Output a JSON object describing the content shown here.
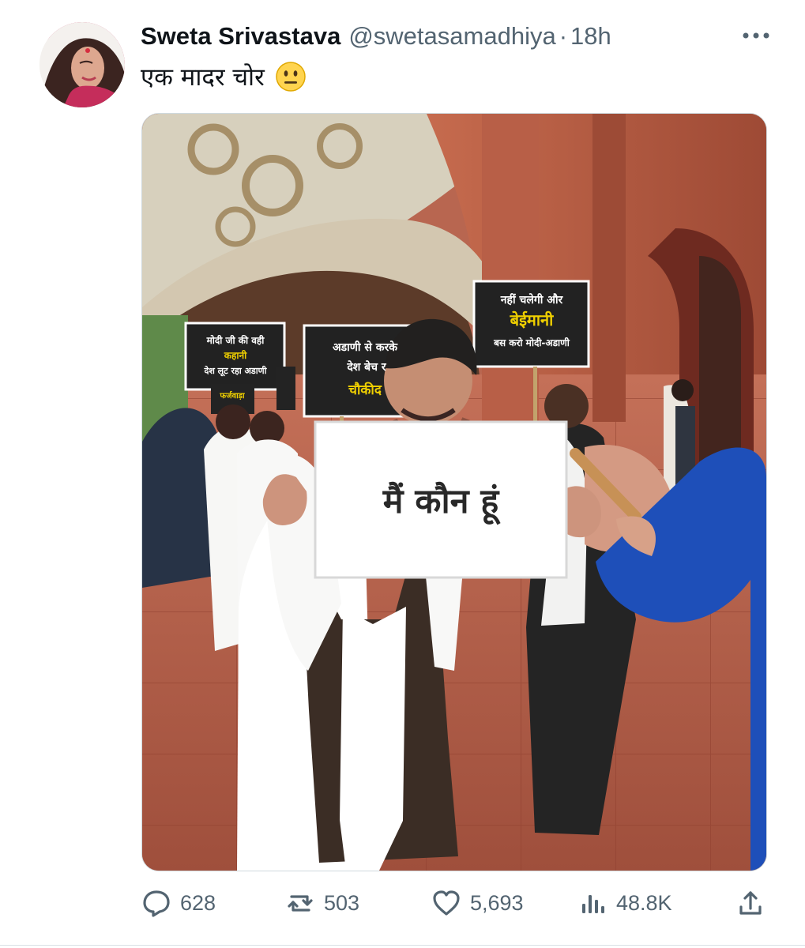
{
  "tweet": {
    "author_name": "Sweta Srivastava",
    "handle": "@swetasamadhiya",
    "separator": "·",
    "time": "18h",
    "text": "एक मादर चोर",
    "emoji": "neutral-face-emoji"
  },
  "media": {
    "main_sign": "मैं कौन हूं",
    "left_sign": [
      "मोदी जी की वही",
      "कहानी",
      "देश लूट रहा अडाणी"
    ],
    "middle_sign": [
      "अडाणी से करके",
      "देश बेच र",
      "चौकीद"
    ],
    "right_sign": [
      "नहीं चलेगी और",
      "बेईमानी",
      "बस करो मोदी-अडाणी"
    ],
    "small_sign": "फर्जवाड़ा"
  },
  "metrics": {
    "replies": "628",
    "reposts": "503",
    "likes": "5,693",
    "views": "48.8K"
  },
  "colors": {
    "text_primary": "#0f1419",
    "text_secondary": "#536471"
  }
}
